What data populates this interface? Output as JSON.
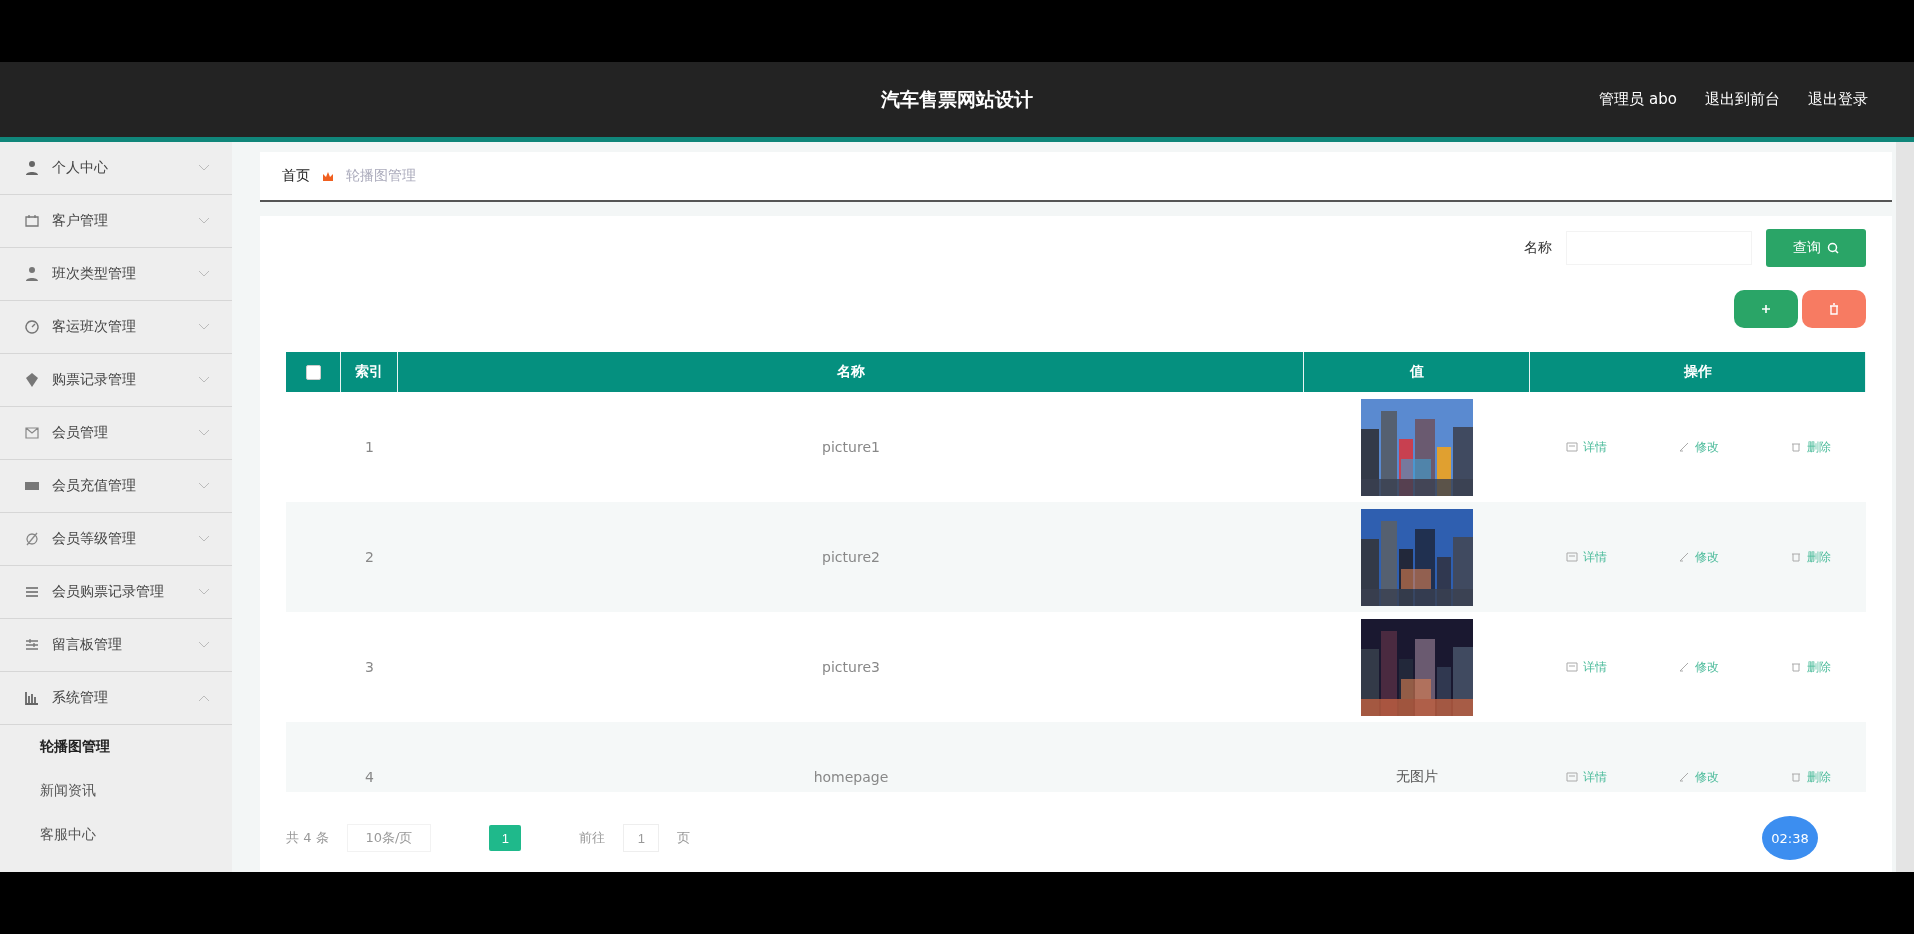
{
  "header": {
    "title": "汽车售票网站设计",
    "links": [
      "管理员 abo",
      "退出到前台",
      "退出登录"
    ]
  },
  "sidebar": {
    "items": [
      {
        "label": "个人中心",
        "expanded": false
      },
      {
        "label": "客户管理",
        "expanded": false
      },
      {
        "label": "班次类型管理",
        "expanded": false
      },
      {
        "label": "客运班次管理",
        "expanded": false
      },
      {
        "label": "购票记录管理",
        "expanded": false
      },
      {
        "label": "会员管理",
        "expanded": false
      },
      {
        "label": "会员充值管理",
        "expanded": false
      },
      {
        "label": "会员等级管理",
        "expanded": false
      },
      {
        "label": "会员购票记录管理",
        "expanded": false
      },
      {
        "label": "留言板管理",
        "expanded": false
      },
      {
        "label": "系统管理",
        "expanded": true,
        "children": [
          {
            "label": "轮播图管理",
            "selected": true
          },
          {
            "label": "新闻资讯",
            "selected": false
          },
          {
            "label": "客服中心",
            "selected": false
          }
        ]
      }
    ]
  },
  "breadcrumb": [
    "首页",
    "轮播图管理"
  ],
  "search": {
    "label": "名称",
    "button": "查询"
  },
  "table": {
    "all_checked": false,
    "columns": [
      "索引",
      "名称",
      "值",
      "操作"
    ],
    "rows": [
      {
        "index": "1",
        "name": "picture1",
        "value": {
          "kind": "picture"
        },
        "actions": [
          "详情",
          "修改",
          "删除"
        ]
      },
      {
        "index": "2",
        "name": "picture2",
        "value": {
          "kind": "picture"
        },
        "actions": [
          "详情",
          "修改",
          "删除"
        ]
      },
      {
        "index": "3",
        "name": "picture3",
        "value": {
          "kind": "picture"
        },
        "actions": [
          "详情",
          "修改",
          "删除"
        ]
      },
      {
        "index": "4",
        "name": "homepage",
        "value": {
          "kind": "text",
          "text": "无图片"
        },
        "actions": [
          "详情",
          "修改",
          "删除"
        ]
      }
    ]
  },
  "pagination": {
    "total": "共 4 条",
    "page_size": "10条/页",
    "pages": [
      {
        "label": "1",
        "selected": true
      }
    ],
    "goto_label": "前往",
    "goto_value": "1",
    "goto_unit": "页"
  },
  "timer": "02:38"
}
